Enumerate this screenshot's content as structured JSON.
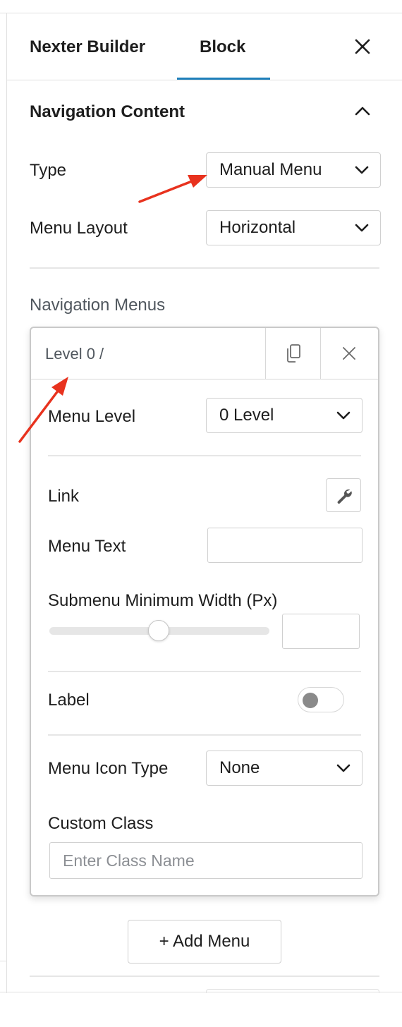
{
  "tabs": [
    {
      "label": "Nexter Builder",
      "active": false
    },
    {
      "label": "Block",
      "active": true
    }
  ],
  "section": {
    "title": "Navigation Content"
  },
  "fields": {
    "type": {
      "label": "Type",
      "value": "Manual Menu"
    },
    "menu_layout": {
      "label": "Menu Layout",
      "value": "Horizontal"
    }
  },
  "navigation_menus": {
    "title": "Navigation Menus",
    "item": {
      "header": "Level 0 /",
      "menu_level": {
        "label": "Menu Level",
        "value": "0 Level"
      },
      "link": {
        "label": "Link"
      },
      "menu_text": {
        "label": "Menu Text",
        "value": ""
      },
      "submenu_min_width": {
        "label": "Submenu Minimum Width (Px)",
        "value": "",
        "slider_fraction": 0.5
      },
      "label_toggle": {
        "label": "Label",
        "on": false
      },
      "menu_icon_type": {
        "label": "Menu Icon Type",
        "value": "None"
      },
      "custom_class": {
        "label": "Custom Class",
        "placeholder": "Enter Class Name",
        "value": ""
      }
    },
    "add_button": "+ Add Menu"
  },
  "colors": {
    "accent": "#1e7fba",
    "annotation_arrow": "#e8321e",
    "text": "#1e1e1e",
    "muted": "#50575e"
  },
  "icons": [
    "close-icon",
    "chevron-up-icon",
    "chevron-down-icon",
    "duplicate-icon",
    "remove-icon",
    "wrench-icon"
  ]
}
